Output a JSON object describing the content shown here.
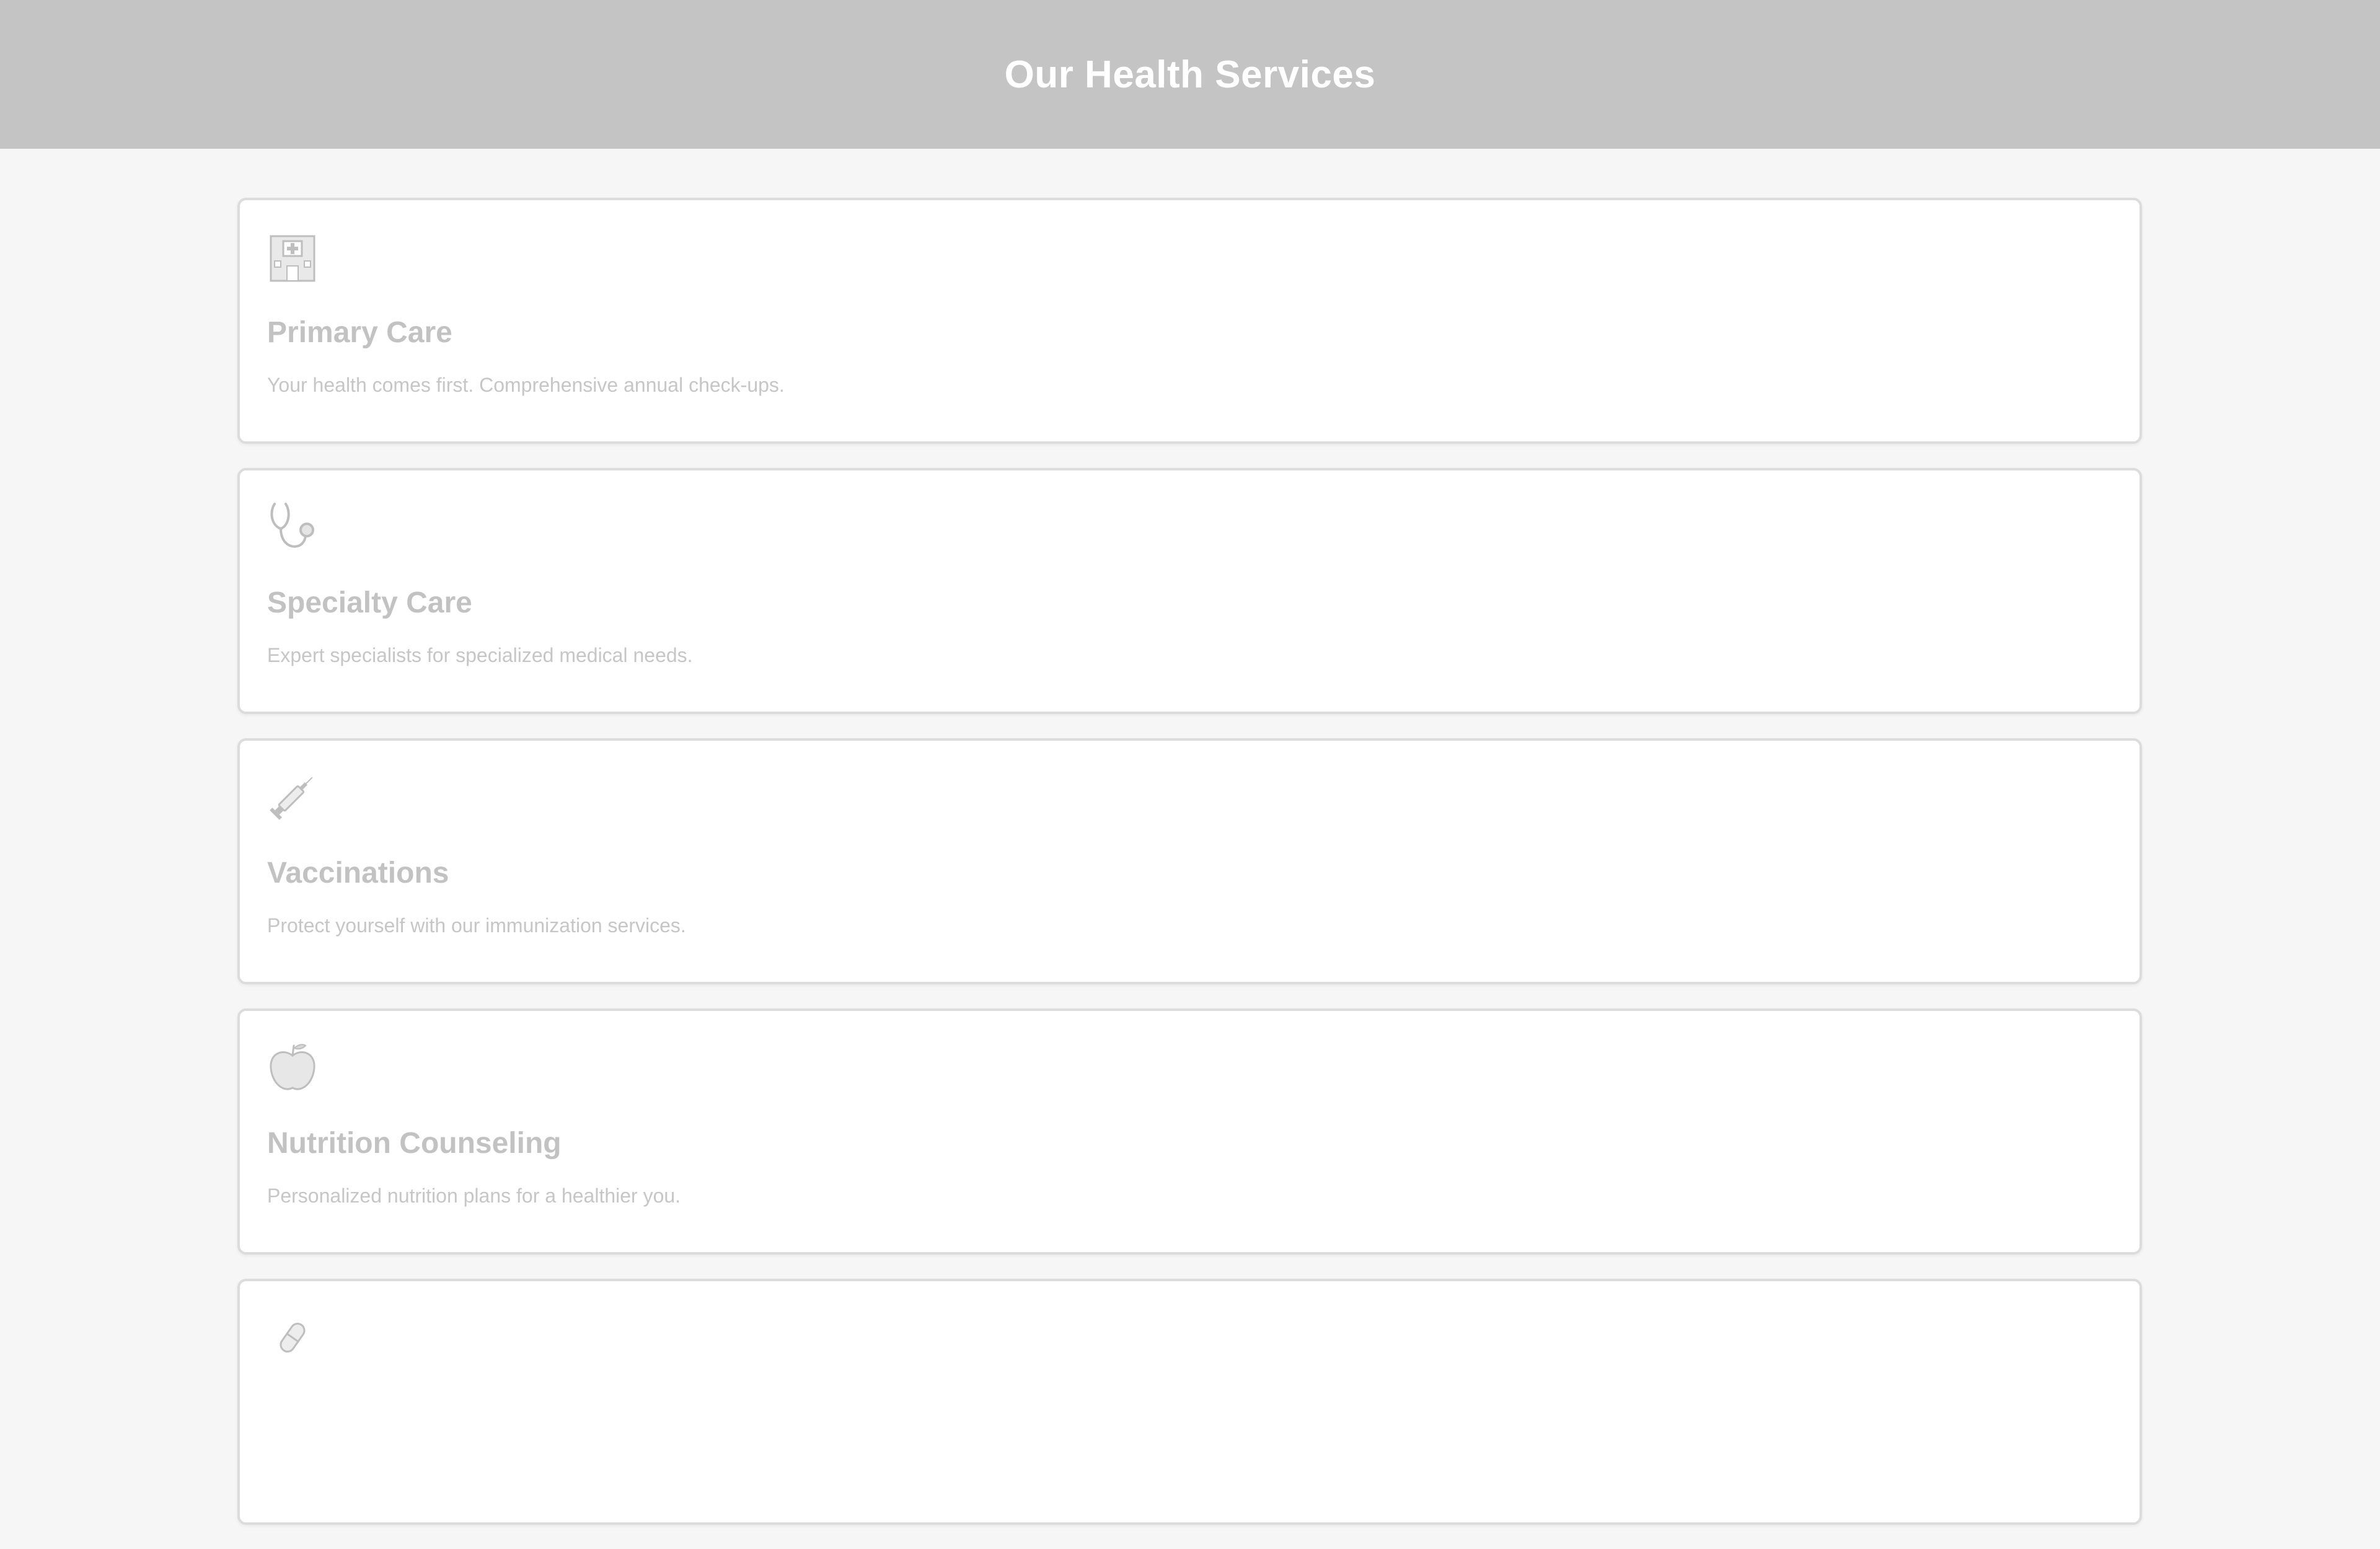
{
  "page": {
    "title": "Our Health Services"
  },
  "services": [
    {
      "icon": "hospital-icon",
      "title": "Primary Care",
      "description": "Your health comes first. Comprehensive annual check-ups."
    },
    {
      "icon": "stethoscope-icon",
      "title": "Specialty Care",
      "description": "Expert specialists for specialized medical needs."
    },
    {
      "icon": "syringe-icon",
      "title": "Vaccinations",
      "description": "Protect yourself with our immunization services."
    },
    {
      "icon": "apple-icon",
      "title": "Nutrition Counseling",
      "description": "Personalized nutrition plans for a healthier you."
    },
    {
      "icon": "pill-icon"
    }
  ]
}
